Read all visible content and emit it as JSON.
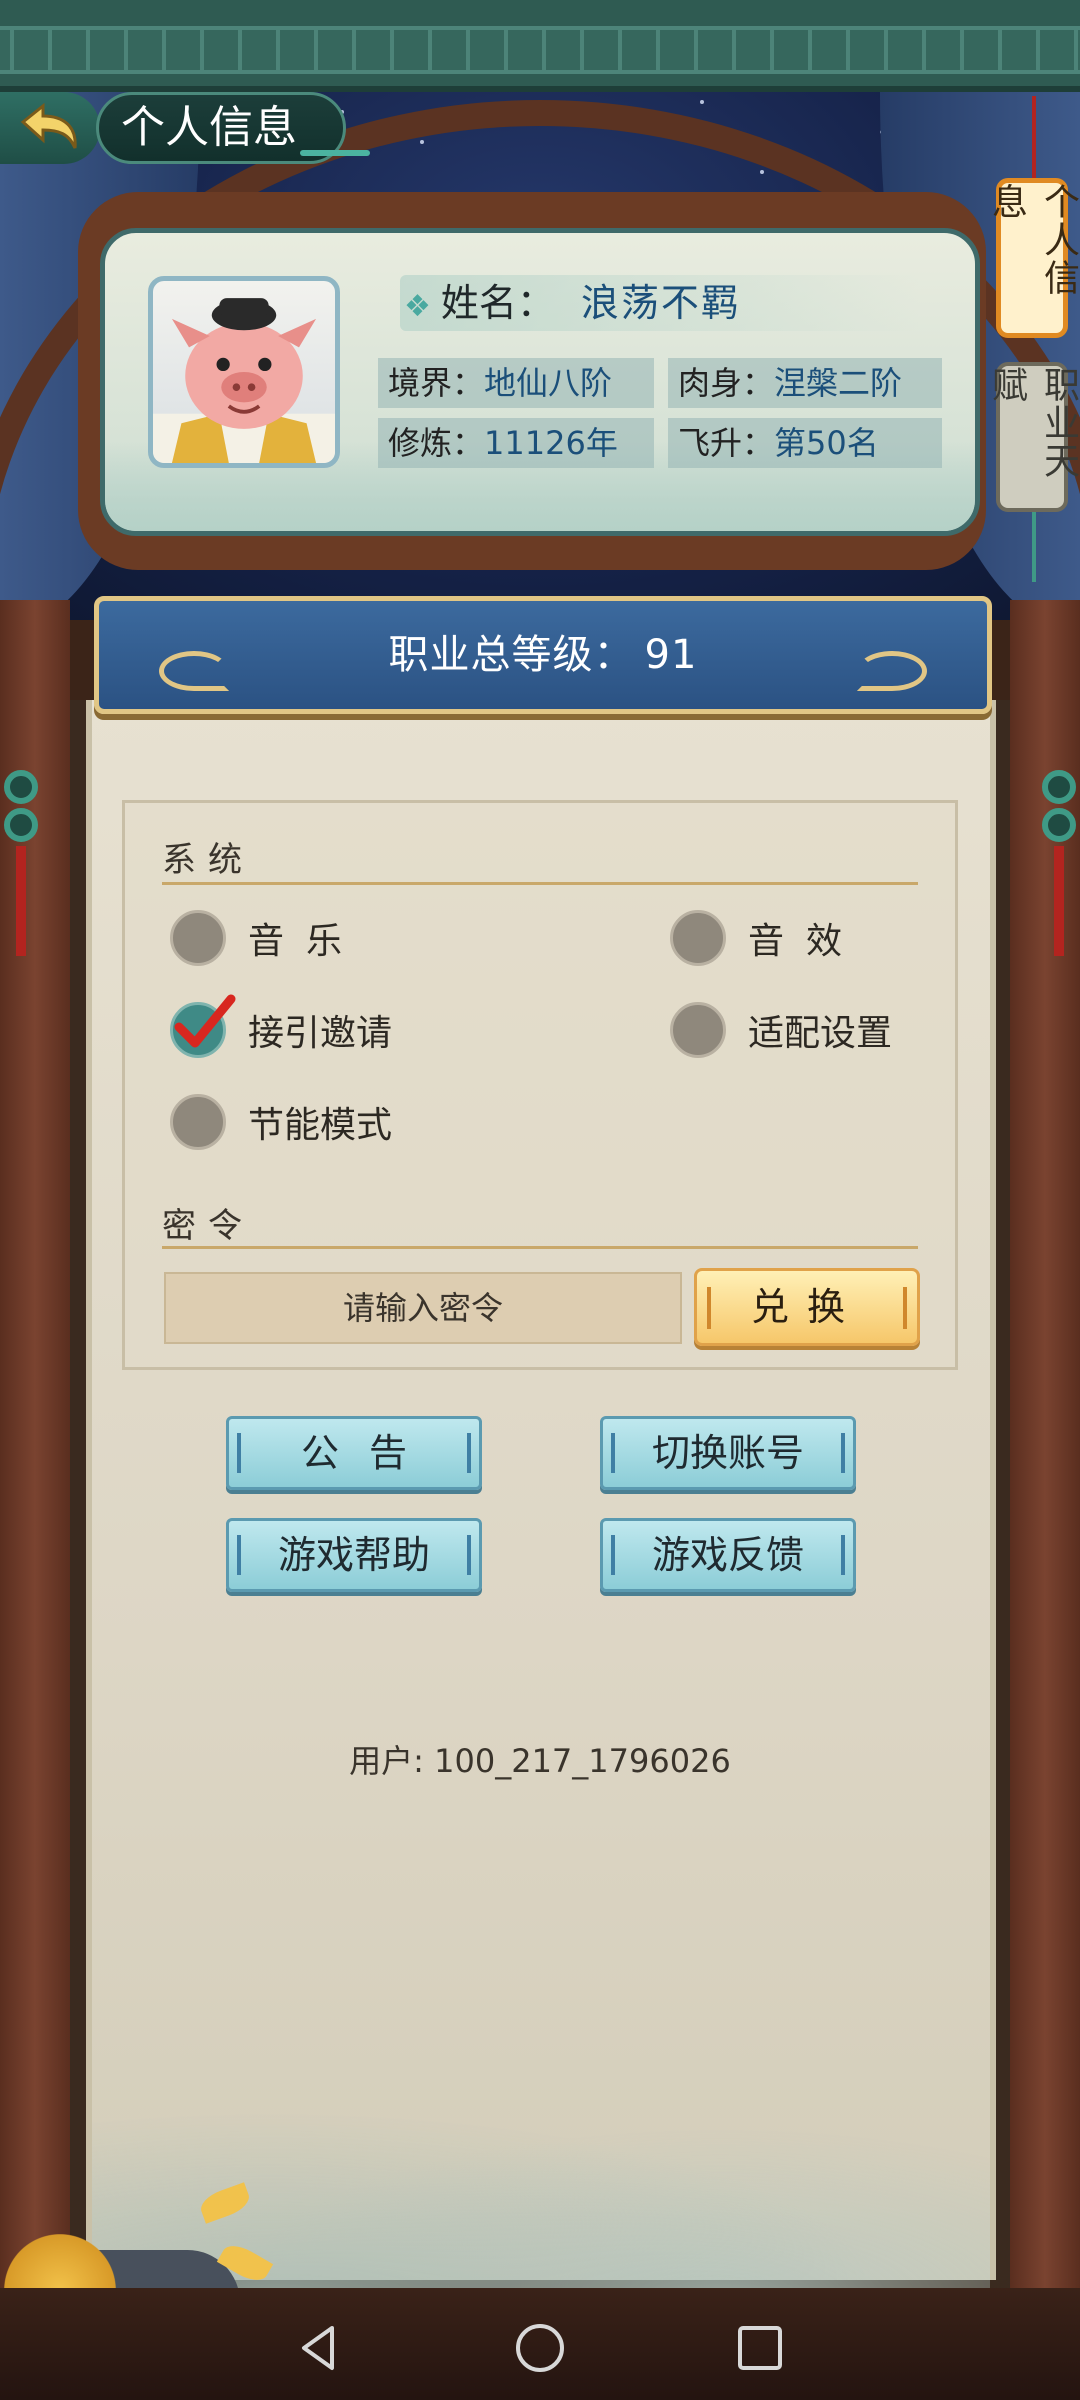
{
  "header": {
    "title": "个人信息",
    "back_icon": "back-arrow-icon"
  },
  "side_tabs": [
    {
      "label": "个人信息",
      "active": true
    },
    {
      "label": "职业天赋",
      "active": false
    }
  ],
  "profile": {
    "name_label": "姓名：",
    "name_value": "浪荡不羁",
    "stats": [
      {
        "label": "境界：",
        "value": "地仙八阶"
      },
      {
        "label": "肉身：",
        "value": "涅槃二阶"
      },
      {
        "label": "修炼：",
        "value": "11126年"
      },
      {
        "label": "飞升：",
        "value": "第50名"
      }
    ]
  },
  "banner": {
    "label": "职业总等级：",
    "value": "91"
  },
  "system": {
    "title": "系统",
    "options": [
      {
        "label": "音乐",
        "checked": false
      },
      {
        "label": "音效",
        "checked": false
      },
      {
        "label": "接引邀请",
        "checked": true
      },
      {
        "label": "适配设置",
        "checked": false
      },
      {
        "label": "节能模式",
        "checked": false
      }
    ]
  },
  "code": {
    "title": "密令",
    "placeholder": "请输入密令",
    "redeem_label": "兑换"
  },
  "actions": {
    "notice": "公告",
    "switch_account": "切换账号",
    "help": "游戏帮助",
    "feedback": "游戏反馈"
  },
  "user": {
    "id_text": "用户: 100_217_1796026"
  },
  "colors": {
    "banner_blue": "#2b5283",
    "accent_gold": "#e1c685",
    "paper": "#e7e1d1",
    "button_cyan": "#8ccdd7",
    "redeem_gold": "#f6c76a"
  }
}
